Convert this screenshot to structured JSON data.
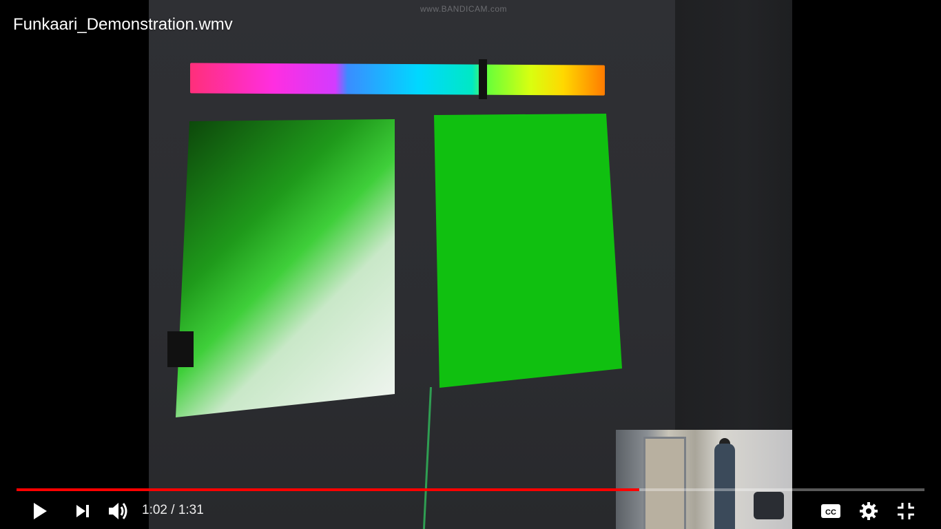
{
  "player": {
    "title": "Funkaari_Demonstration.wmv",
    "watermark": "www.BANDICAM.com",
    "time": {
      "current": "1:02",
      "separator": "/",
      "duration": "1:31"
    },
    "progress_fraction": 0.686,
    "accent_color": "#ff0000",
    "controls": {
      "play": "play-icon",
      "next": "next-icon",
      "volume": "volume-icon",
      "captions": "captions-icon",
      "settings": "gear-icon",
      "fullscreen": "exit-fullscreen-icon"
    }
  }
}
